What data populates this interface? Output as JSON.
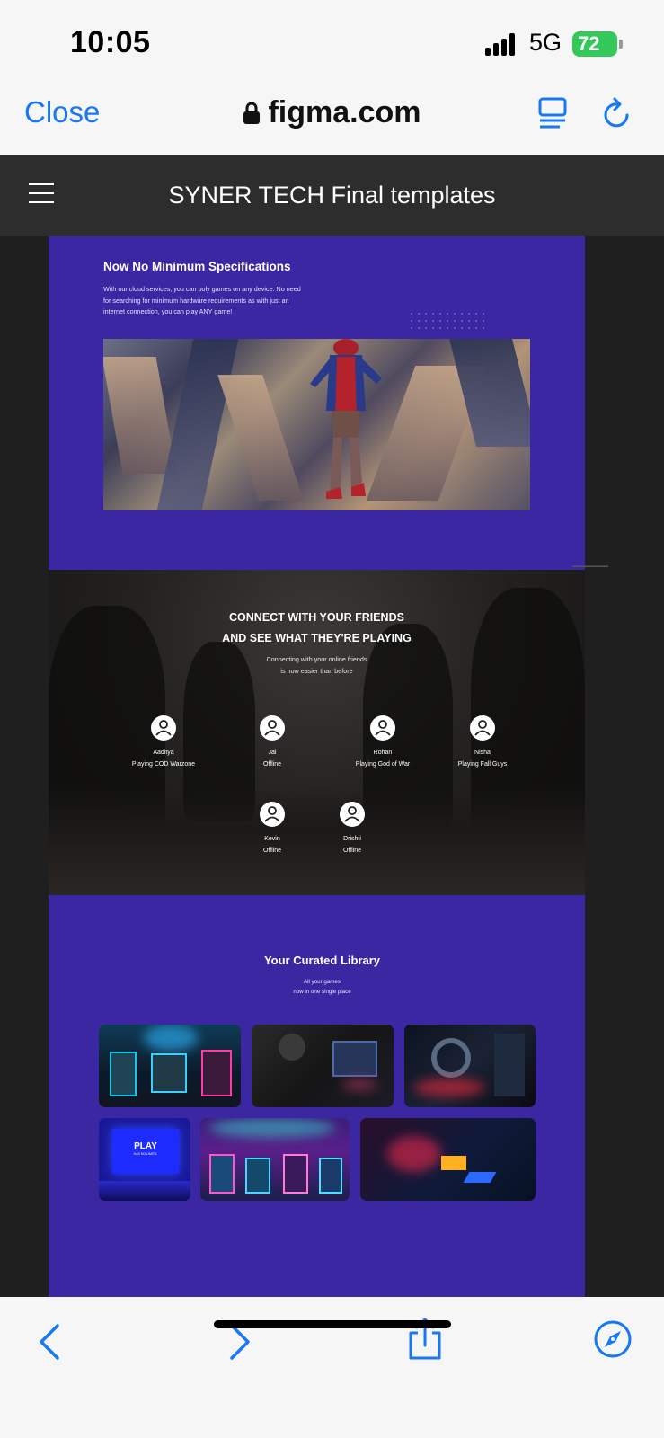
{
  "status_bar": {
    "time": "10:05",
    "network": "5G",
    "battery": "72"
  },
  "browser": {
    "close_label": "Close",
    "url": "figma.com"
  },
  "figma": {
    "file_title": "SYNER TECH Final templates"
  },
  "section_specs": {
    "title": "Now No Minimum Specifications",
    "description": "With our cloud services, you can poly games on any device. No need for searching for minimum hardware requirements as with just an internet connection, you can play ANY game!"
  },
  "section_friends": {
    "title_line1": "CONNECT WITH YOUR FRIENDS",
    "title_line2": "AND SEE WHAT THEY'RE PLAYING",
    "subtitle_line1": "Connecting with your online friends",
    "subtitle_line2": "is now easier than before",
    "friends": [
      {
        "name": "Aaditya",
        "status": "Playing COD Warzone"
      },
      {
        "name": "Jai",
        "status": "Offline"
      },
      {
        "name": "Rohan",
        "status": "Playing God of War"
      },
      {
        "name": "Nisha",
        "status": "Playing Fall Guys"
      },
      {
        "name": "Kevin",
        "status": "Offline"
      },
      {
        "name": "Drishti",
        "status": "Offline"
      }
    ]
  },
  "section_library": {
    "title": "Your Curated Library",
    "subtitle_line1": "All your games",
    "subtitle_line2": "now in one single place",
    "play_tile_title": "PLAY",
    "play_tile_sub": "HAS NO LIMITS."
  },
  "colors": {
    "section_purple": "#3b27a1",
    "ios_blue": "#1877f2",
    "battery_green": "#34c759",
    "figma_header": "#2d2d2d"
  }
}
